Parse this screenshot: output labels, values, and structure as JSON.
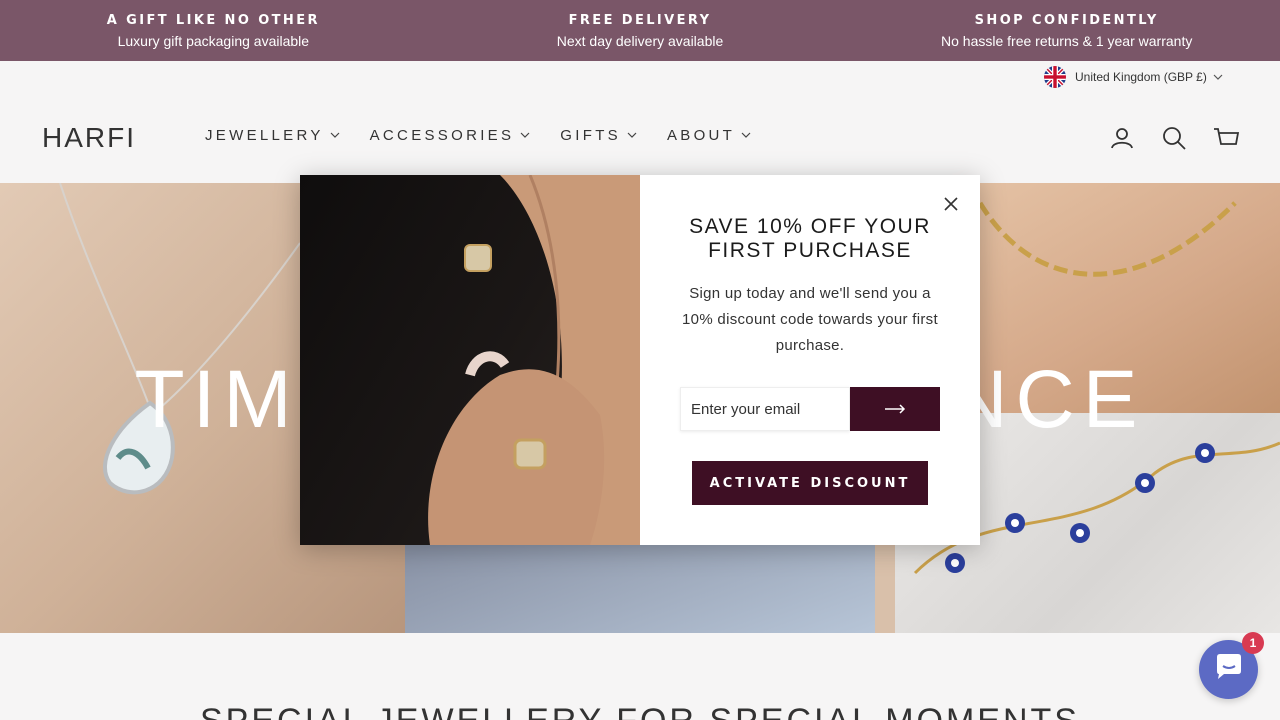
{
  "announcement": [
    {
      "title": "A GIFT LIKE NO OTHER",
      "subtitle": "Luxury gift packaging available"
    },
    {
      "title": "FREE DELIVERY",
      "subtitle": "Next day delivery available"
    },
    {
      "title": "SHOP CONFIDENTLY",
      "subtitle": "No hassle free returns & 1 year warranty"
    }
  ],
  "colors": {
    "announcement_bg": "#7a5668",
    "brand_dark": "#3e0f24",
    "chat": "#5c6ac4",
    "badge": "#d83a52"
  },
  "locale": {
    "label": "United Kingdom (GBP £)",
    "icon": "uk-flag-icon"
  },
  "header": {
    "logo": "HARFI",
    "nav": [
      {
        "label": "JEWELLERY"
      },
      {
        "label": "ACCESSORIES"
      },
      {
        "label": "GIFTS"
      },
      {
        "label": "ABOUT"
      }
    ],
    "icons": [
      "account-icon",
      "search-icon",
      "cart-icon"
    ],
    "icon_labels": [
      "LOG IN",
      "SEARCH",
      "CART"
    ]
  },
  "hero": {
    "title": "TIMELESS ELEGANCE"
  },
  "section": {
    "title": "SPECIAL JEWELLERY FOR SPECIAL MOMENTS"
  },
  "popup": {
    "title_line1": "SAVE 10% OFF YOUR",
    "title_line2": "FIRST PURCHASE",
    "text": "Sign up today and we'll send you a 10% discount code towards your first purchase.",
    "email_placeholder": "Enter your email",
    "submit_icon": "arrow-right-icon",
    "cta": "ACTIVATE DISCOUNT"
  },
  "chat": {
    "badge": "1",
    "icon": "chat-icon"
  }
}
